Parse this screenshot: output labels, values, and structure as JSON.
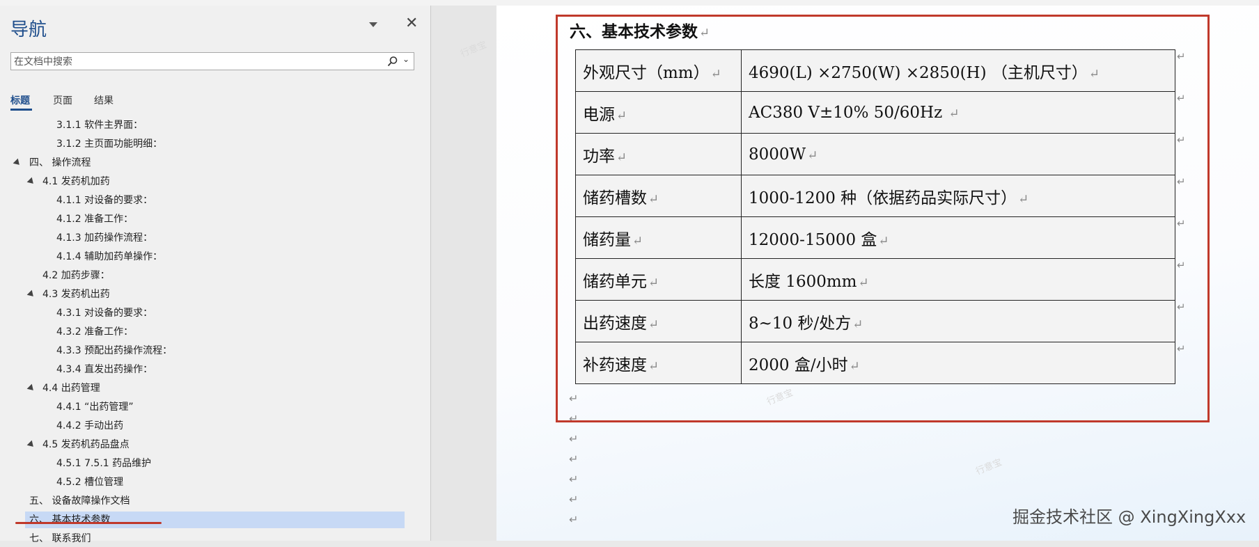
{
  "nav": {
    "title": "导航",
    "search_placeholder": "在文档中搜索",
    "tabs": [
      "标题",
      "页面",
      "结果"
    ],
    "items": [
      {
        "label": "3.1.1 软件主界面：",
        "level": 2,
        "expand": false,
        "selected": false
      },
      {
        "label": "3.1.2 主页面功能明细：",
        "level": 2,
        "expand": false,
        "selected": false
      },
      {
        "label": "四、 操作流程",
        "level": 0,
        "expand": true,
        "selected": false
      },
      {
        "label": "4.1 发药机加药",
        "level": 1,
        "expand": true,
        "selected": false
      },
      {
        "label": "4.1.1 对设备的要求：",
        "level": 2,
        "expand": false,
        "selected": false
      },
      {
        "label": "4.1.2 准备工作：",
        "level": 2,
        "expand": false,
        "selected": false
      },
      {
        "label": "4.1.3 加药操作流程：",
        "level": 2,
        "expand": false,
        "selected": false
      },
      {
        "label": "4.1.4 辅助加药单操作：",
        "level": 2,
        "expand": false,
        "selected": false
      },
      {
        "label": "4.2 加药步骤：",
        "level": 1,
        "expand": false,
        "selected": false
      },
      {
        "label": "4.3 发药机出药",
        "level": 1,
        "expand": true,
        "selected": false
      },
      {
        "label": "4.3.1 对设备的要求：",
        "level": 2,
        "expand": false,
        "selected": false
      },
      {
        "label": "4.3.2 准备工作：",
        "level": 2,
        "expand": false,
        "selected": false
      },
      {
        "label": "4.3.3 预配出药操作流程：",
        "level": 2,
        "expand": false,
        "selected": false
      },
      {
        "label": "4.3.4 直发出药操作：",
        "level": 2,
        "expand": false,
        "selected": false
      },
      {
        "label": "4.4 出药管理",
        "level": 1,
        "expand": true,
        "selected": false
      },
      {
        "label": "4.4.1 “出药管理”",
        "level": 2,
        "expand": false,
        "selected": false
      },
      {
        "label": "4.4.2  手动出药",
        "level": 2,
        "expand": false,
        "selected": false
      },
      {
        "label": "4.5  发药机药品盘点",
        "level": 1,
        "expand": true,
        "selected": false
      },
      {
        "label": "4.5.1 7.5.1 药品维护",
        "level": 2,
        "expand": false,
        "selected": false
      },
      {
        "label": "4.5.2 槽位管理",
        "level": 2,
        "expand": false,
        "selected": false
      },
      {
        "label": "五、 设备故障操作文档",
        "level": 0,
        "expand": false,
        "selected": false
      },
      {
        "label": "六、 基本技术参数",
        "level": 0,
        "expand": false,
        "selected": true
      },
      {
        "label": "七、 联系我们",
        "level": 0,
        "expand": false,
        "selected": false
      }
    ]
  },
  "doc": {
    "heading": "六、基本技术参数",
    "mark": "↵",
    "rows": [
      {
        "k": "外观尺寸（mm）",
        "v": "4690(L) ×2750(W) ×2850(H) （主机尺寸）"
      },
      {
        "k": "电源",
        "v": "AC380 V±10%  50/60Hz "
      },
      {
        "k": "功率",
        "v": "8000W"
      },
      {
        "k": "储药槽数",
        "v": "1000-1200 种（依据药品实际尺寸）"
      },
      {
        "k": "储药量",
        "v": "12000-15000 盒"
      },
      {
        "k": "储药单元",
        "v": "长度 1600mm"
      },
      {
        "k": "出药速度",
        "v": "8~10 秒/处方"
      },
      {
        "k": "补药速度",
        "v": "2000 盒/小时"
      }
    ]
  },
  "watermark": "掘金技术社区 @ XingXingXxx"
}
